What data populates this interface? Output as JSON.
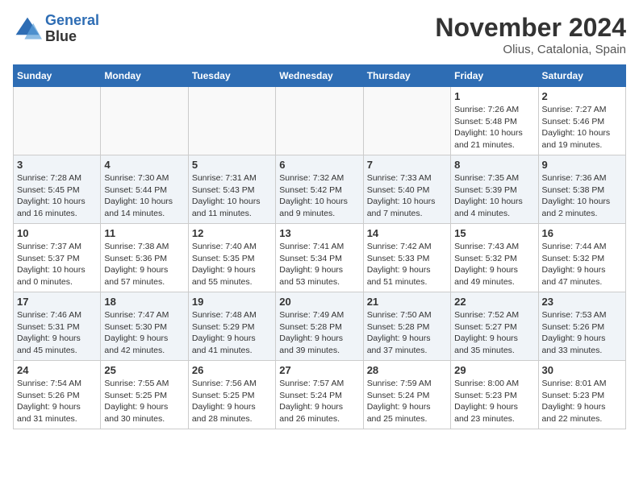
{
  "header": {
    "logo_line1": "General",
    "logo_line2": "Blue",
    "month_year": "November 2024",
    "location": "Olius, Catalonia, Spain"
  },
  "weekdays": [
    "Sunday",
    "Monday",
    "Tuesday",
    "Wednesday",
    "Thursday",
    "Friday",
    "Saturday"
  ],
  "weeks": [
    [
      {
        "day": "",
        "info": ""
      },
      {
        "day": "",
        "info": ""
      },
      {
        "day": "",
        "info": ""
      },
      {
        "day": "",
        "info": ""
      },
      {
        "day": "",
        "info": ""
      },
      {
        "day": "1",
        "info": "Sunrise: 7:26 AM\nSunset: 5:48 PM\nDaylight: 10 hours\nand 21 minutes."
      },
      {
        "day": "2",
        "info": "Sunrise: 7:27 AM\nSunset: 5:46 PM\nDaylight: 10 hours\nand 19 minutes."
      }
    ],
    [
      {
        "day": "3",
        "info": "Sunrise: 7:28 AM\nSunset: 5:45 PM\nDaylight: 10 hours\nand 16 minutes."
      },
      {
        "day": "4",
        "info": "Sunrise: 7:30 AM\nSunset: 5:44 PM\nDaylight: 10 hours\nand 14 minutes."
      },
      {
        "day": "5",
        "info": "Sunrise: 7:31 AM\nSunset: 5:43 PM\nDaylight: 10 hours\nand 11 minutes."
      },
      {
        "day": "6",
        "info": "Sunrise: 7:32 AM\nSunset: 5:42 PM\nDaylight: 10 hours\nand 9 minutes."
      },
      {
        "day": "7",
        "info": "Sunrise: 7:33 AM\nSunset: 5:40 PM\nDaylight: 10 hours\nand 7 minutes."
      },
      {
        "day": "8",
        "info": "Sunrise: 7:35 AM\nSunset: 5:39 PM\nDaylight: 10 hours\nand 4 minutes."
      },
      {
        "day": "9",
        "info": "Sunrise: 7:36 AM\nSunset: 5:38 PM\nDaylight: 10 hours\nand 2 minutes."
      }
    ],
    [
      {
        "day": "10",
        "info": "Sunrise: 7:37 AM\nSunset: 5:37 PM\nDaylight: 10 hours\nand 0 minutes."
      },
      {
        "day": "11",
        "info": "Sunrise: 7:38 AM\nSunset: 5:36 PM\nDaylight: 9 hours\nand 57 minutes."
      },
      {
        "day": "12",
        "info": "Sunrise: 7:40 AM\nSunset: 5:35 PM\nDaylight: 9 hours\nand 55 minutes."
      },
      {
        "day": "13",
        "info": "Sunrise: 7:41 AM\nSunset: 5:34 PM\nDaylight: 9 hours\nand 53 minutes."
      },
      {
        "day": "14",
        "info": "Sunrise: 7:42 AM\nSunset: 5:33 PM\nDaylight: 9 hours\nand 51 minutes."
      },
      {
        "day": "15",
        "info": "Sunrise: 7:43 AM\nSunset: 5:32 PM\nDaylight: 9 hours\nand 49 minutes."
      },
      {
        "day": "16",
        "info": "Sunrise: 7:44 AM\nSunset: 5:32 PM\nDaylight: 9 hours\nand 47 minutes."
      }
    ],
    [
      {
        "day": "17",
        "info": "Sunrise: 7:46 AM\nSunset: 5:31 PM\nDaylight: 9 hours\nand 45 minutes."
      },
      {
        "day": "18",
        "info": "Sunrise: 7:47 AM\nSunset: 5:30 PM\nDaylight: 9 hours\nand 42 minutes."
      },
      {
        "day": "19",
        "info": "Sunrise: 7:48 AM\nSunset: 5:29 PM\nDaylight: 9 hours\nand 41 minutes."
      },
      {
        "day": "20",
        "info": "Sunrise: 7:49 AM\nSunset: 5:28 PM\nDaylight: 9 hours\nand 39 minutes."
      },
      {
        "day": "21",
        "info": "Sunrise: 7:50 AM\nSunset: 5:28 PM\nDaylight: 9 hours\nand 37 minutes."
      },
      {
        "day": "22",
        "info": "Sunrise: 7:52 AM\nSunset: 5:27 PM\nDaylight: 9 hours\nand 35 minutes."
      },
      {
        "day": "23",
        "info": "Sunrise: 7:53 AM\nSunset: 5:26 PM\nDaylight: 9 hours\nand 33 minutes."
      }
    ],
    [
      {
        "day": "24",
        "info": "Sunrise: 7:54 AM\nSunset: 5:26 PM\nDaylight: 9 hours\nand 31 minutes."
      },
      {
        "day": "25",
        "info": "Sunrise: 7:55 AM\nSunset: 5:25 PM\nDaylight: 9 hours\nand 30 minutes."
      },
      {
        "day": "26",
        "info": "Sunrise: 7:56 AM\nSunset: 5:25 PM\nDaylight: 9 hours\nand 28 minutes."
      },
      {
        "day": "27",
        "info": "Sunrise: 7:57 AM\nSunset: 5:24 PM\nDaylight: 9 hours\nand 26 minutes."
      },
      {
        "day": "28",
        "info": "Sunrise: 7:59 AM\nSunset: 5:24 PM\nDaylight: 9 hours\nand 25 minutes."
      },
      {
        "day": "29",
        "info": "Sunrise: 8:00 AM\nSunset: 5:23 PM\nDaylight: 9 hours\nand 23 minutes."
      },
      {
        "day": "30",
        "info": "Sunrise: 8:01 AM\nSunset: 5:23 PM\nDaylight: 9 hours\nand 22 minutes."
      }
    ]
  ]
}
